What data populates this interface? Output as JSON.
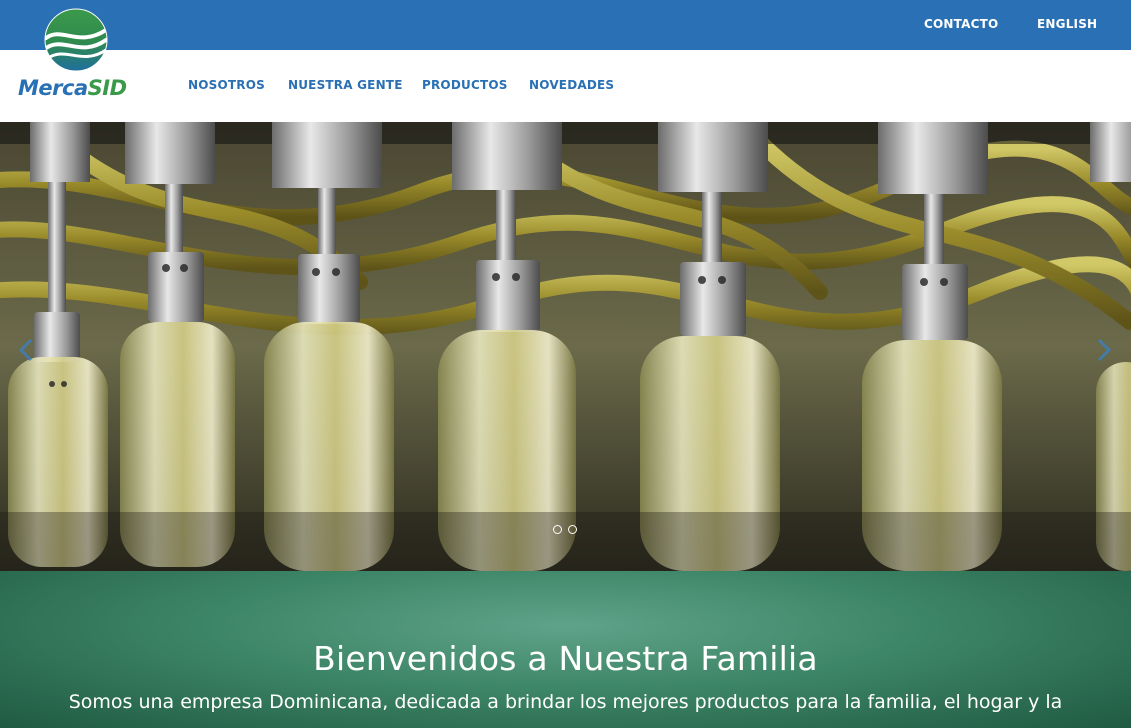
{
  "brand": {
    "name_prefix": "Merca",
    "name_suffix": "SID",
    "colors": {
      "primary_blue": "#2a70b5",
      "green": "#3a9a4a",
      "welcome_green": "#3d8567"
    }
  },
  "topbar": {
    "links": [
      {
        "label": "CONTACTO"
      },
      {
        "label": "ENGLISH"
      }
    ]
  },
  "nav": {
    "items": [
      {
        "label": "NOSOTROS"
      },
      {
        "label": "NUESTRA GENTE"
      },
      {
        "label": "PRODUCTOS"
      },
      {
        "label": "NOVEDADES"
      }
    ]
  },
  "hero": {
    "image_subject": "oil bottle filling line",
    "prev_icon": "chevron-left-icon",
    "next_icon": "chevron-right-icon",
    "slide_count": 2
  },
  "welcome": {
    "title": "Bienvenidos a Nuestra Familia",
    "text": "Somos una empresa Dominicana, dedicada a brindar los mejores productos para la familia, el hogar y la"
  }
}
